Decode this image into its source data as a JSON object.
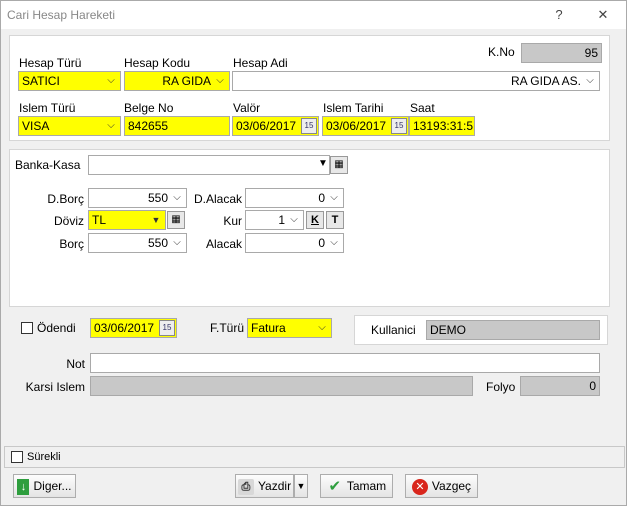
{
  "window": {
    "title": "Cari Hesap Hareketi",
    "help_label": "?",
    "close_label": "✕"
  },
  "header": {
    "kno_label": "K.No",
    "kno_value": "95",
    "hesap_turu_label": "Hesap Türü",
    "hesap_turu_value": "SATICI",
    "hesap_kodu_label": "Hesap Kodu",
    "hesap_kodu_value": "RA GIDA",
    "hesap_adi_label": "Hesap Adi",
    "hesap_adi_value": "RA GIDA  AS.",
    "islem_turu_label": "Islem Türü",
    "islem_turu_value": "VISA",
    "belge_no_label": "Belge No",
    "belge_no_value": "842655",
    "valor_label": "Valör",
    "valor_value": "03/06/2017",
    "islem_tarihi_label": "Islem Tarihi",
    "islem_tarihi_value": "03/06/2017",
    "saat_label": "Saat",
    "saat_value": "13193:31:5"
  },
  "amounts": {
    "banka_kasa_label": "Banka-Kasa",
    "banka_kasa_value": "",
    "dborc_label": "D.Borç",
    "dborc_value": "550",
    "dalacak_label": "D.Alacak",
    "dalacak_value": "0",
    "doviz_label": "Döviz",
    "doviz_value": "TL",
    "kur_label": "Kur",
    "kur_value": "1",
    "k_button": "K",
    "t_button": "T",
    "borc_label": "Borç",
    "borc_value": "550",
    "alacak_label": "Alacak",
    "alacak_value": "0"
  },
  "status": {
    "odendi_label": "Ödendi",
    "odendi_date": "03/06/2017",
    "fturu_label": "F.Türü",
    "fturu_value": "Fatura",
    "kullanici_label": "Kullanici",
    "kullanici_value": "DEMO"
  },
  "notes": {
    "not_label": "Not",
    "not_value": "",
    "karsi_islem_label": "Karsi Islem",
    "karsi_islem_value": "",
    "folyo_label": "Folyo",
    "folyo_value": "0"
  },
  "footer": {
    "surekli_label": "Sürekli",
    "diger_label": "Diger...",
    "yazdir_label": "Yazdir",
    "tamam_label": "Tamam",
    "vazgec_label": "Vazgeç"
  }
}
